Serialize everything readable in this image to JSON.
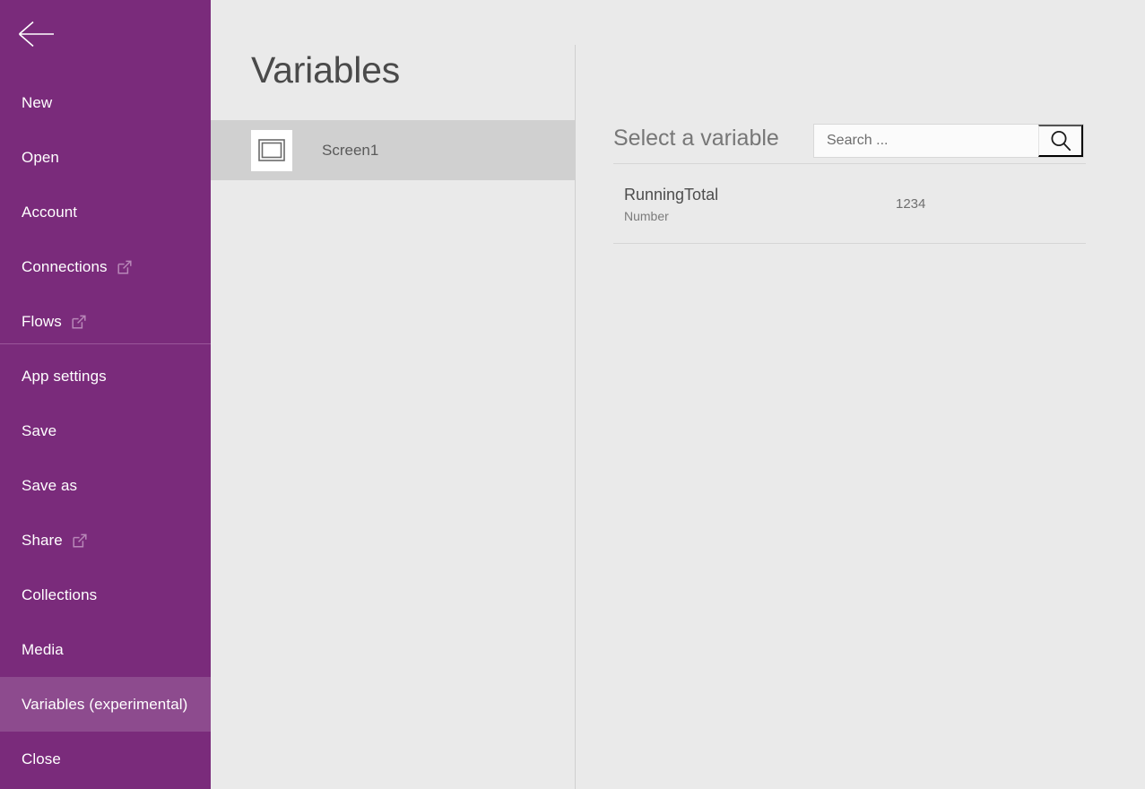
{
  "sidebar": {
    "back_icon": "back-arrow-icon",
    "accent_color": "#7a2b7b",
    "selected_color": "#8d4b8e",
    "top_items": [
      {
        "label": "New",
        "external": false
      },
      {
        "label": "Open",
        "external": false
      },
      {
        "label": "Account",
        "external": false
      },
      {
        "label": "Connections",
        "external": true
      },
      {
        "label": "Flows",
        "external": true
      }
    ],
    "bottom_items": [
      {
        "label": "App settings",
        "external": false,
        "selected": false
      },
      {
        "label": "Save",
        "external": false,
        "selected": false
      },
      {
        "label": "Save as",
        "external": false,
        "selected": false
      },
      {
        "label": "Share",
        "external": true,
        "selected": false
      },
      {
        "label": "Collections",
        "external": false,
        "selected": false
      },
      {
        "label": "Media",
        "external": false,
        "selected": false
      },
      {
        "label": "Variables (experimental)",
        "external": false,
        "selected": true
      },
      {
        "label": "Close",
        "external": false,
        "selected": false
      }
    ]
  },
  "mid_pane": {
    "title": "Variables",
    "screens": [
      {
        "name": "Screen1",
        "icon": "screen-thumbnail-icon",
        "selected": true
      }
    ]
  },
  "right_pane": {
    "select_label": "Select a variable",
    "search": {
      "value": "",
      "placeholder": "Search ...",
      "icon": "search-icon"
    },
    "variables": [
      {
        "name": "RunningTotal",
        "type": "Number",
        "value": "1234"
      }
    ]
  }
}
